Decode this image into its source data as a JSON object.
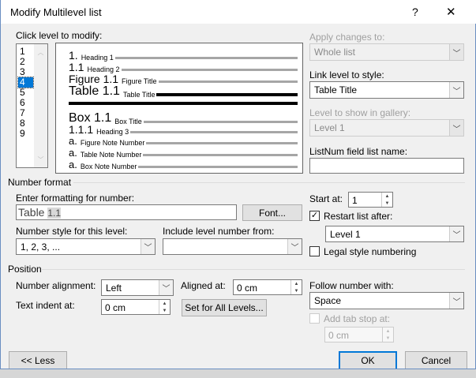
{
  "title": "Modify Multilevel list",
  "help": "?",
  "close": "✕",
  "click_level_label": "Click level to modify:",
  "levels": [
    "1",
    "2",
    "3",
    "4",
    "5",
    "6",
    "7",
    "8",
    "9"
  ],
  "selected_level": "4",
  "preview": [
    {
      "num": "1.",
      "text": "Heading 1",
      "bold": false
    },
    {
      "num": "1.1",
      "text": "Heading 2",
      "bold": false
    },
    {
      "num": "Figure 1.1",
      "text": "Figure Title",
      "bold": false
    },
    {
      "num": "Table 1.1",
      "text": "Table Title",
      "bold": true
    },
    {
      "num": "Box 1.1",
      "text": "Box Title",
      "bold": false
    },
    {
      "num": "1.1.1",
      "text": "Heading 3",
      "bold": false
    },
    {
      "num": "a.",
      "text": "Figure Note Number",
      "bold": false
    },
    {
      "num": "a.",
      "text": "Table Note Number",
      "bold": false
    },
    {
      "num": "a.",
      "text": "Box Note Number",
      "bold": false
    }
  ],
  "apply_changes_label": "Apply changes to:",
  "apply_changes_value": "Whole list",
  "link_style_label": "Link level to style:",
  "link_style_value": "Table Title",
  "gallery_label": "Level to show in gallery:",
  "gallery_value": "Level 1",
  "listnum_label": "ListNum field list name:",
  "listnum_value": "",
  "number_format": {
    "group": "Number format",
    "enter_label": "Enter formatting for number:",
    "format_text": "Table ",
    "format_field": "1.1",
    "font_button": "Font...",
    "style_label": "Number style for this level:",
    "style_value": "1, 2, 3, ...",
    "include_label": "Include level number from:",
    "include_value": "",
    "start_label": "Start at:",
    "start_value": "1",
    "restart_label": "Restart list after:",
    "restart_checked": true,
    "restart_value": "Level 1",
    "legal_label": "Legal style numbering",
    "legal_checked": false
  },
  "position": {
    "group": "Position",
    "alignment_label": "Number alignment:",
    "alignment_value": "Left",
    "aligned_at_label": "Aligned at:",
    "aligned_at_value": "0 cm",
    "indent_label": "Text indent at:",
    "indent_value": "0 cm",
    "set_all_button": "Set for All Levels...",
    "follow_label": "Follow number with:",
    "follow_value": "Space",
    "tab_stop_label": "Add tab stop at:",
    "tab_stop_checked": false,
    "tab_stop_value": "0 cm"
  },
  "less_button": "<< Less",
  "ok_button": "OK",
  "cancel_button": "Cancel"
}
